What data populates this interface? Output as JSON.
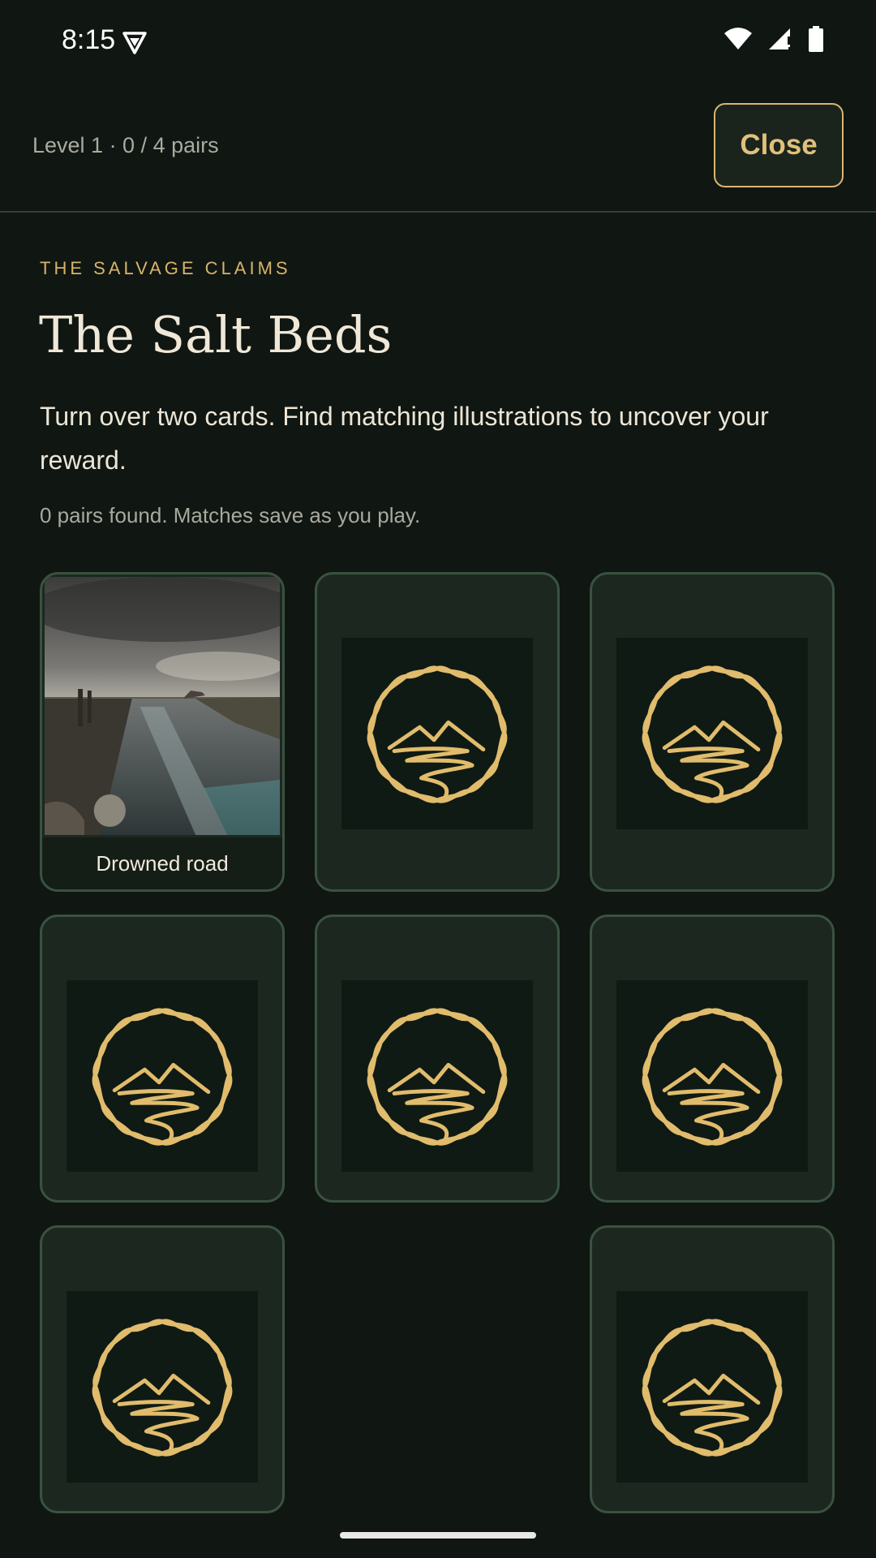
{
  "status_bar": {
    "time": "8:15",
    "icons": [
      "vpn-shield-icon",
      "wifi-icon",
      "signal-icon",
      "battery-icon"
    ]
  },
  "header": {
    "level_text": "Level 1 · 0 / 4 pairs",
    "close_label": "Close"
  },
  "main": {
    "eyebrow": "THE SALVAGE CLAIMS",
    "title": "The Salt Beds",
    "description": "Turn over two cards. Find matching illustrations to uncover your reward.",
    "status": "0 pairs found. Matches save as you play."
  },
  "cards": [
    {
      "state": "revealed",
      "caption": "Drowned road"
    },
    {
      "state": "hidden",
      "icon": "river-emblem-icon"
    },
    {
      "state": "hidden",
      "icon": "river-emblem-icon"
    },
    {
      "state": "hidden",
      "icon": "river-emblem-icon"
    },
    {
      "state": "hidden",
      "icon": "river-emblem-icon"
    },
    {
      "state": "hidden",
      "icon": "river-emblem-icon"
    },
    {
      "state": "hidden",
      "icon": "river-emblem-icon"
    },
    {
      "state": "empty"
    },
    {
      "state": "hidden",
      "icon": "river-emblem-icon"
    }
  ],
  "colors": {
    "accent": "#d9b86e",
    "card_border": "#3a5240",
    "card_bg": "#1c281f",
    "background": "#101612"
  }
}
